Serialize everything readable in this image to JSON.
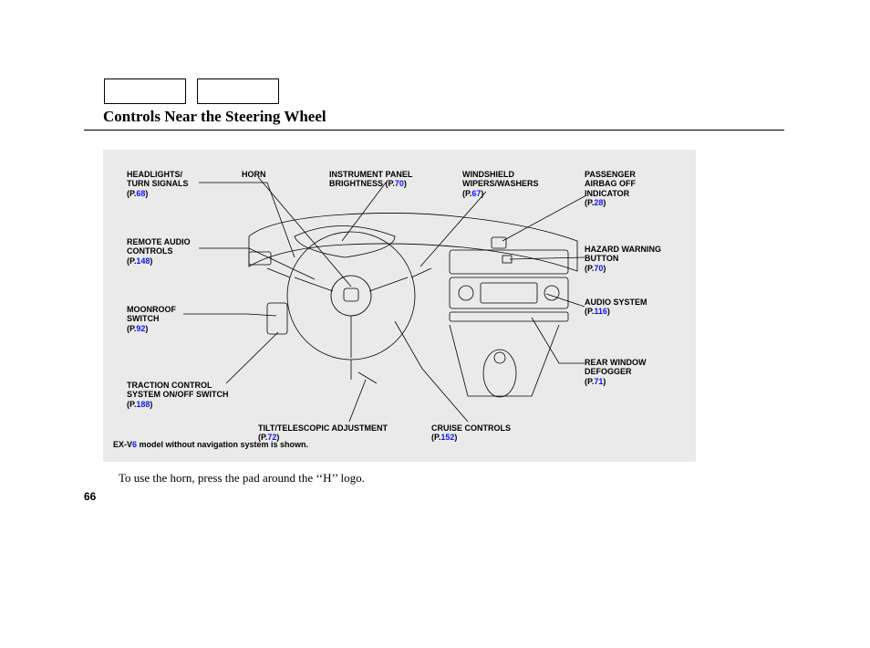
{
  "title": "Controls Near the Steering Wheel",
  "page_number": "66",
  "body_text": "To use the horn, press the pad around the ‘‘H’’ logo.",
  "note_prefix": "EX-V",
  "note_highlight": "6",
  "note_suffix": " model without navigation system is shown.",
  "callouts": {
    "headlights": {
      "label": "HEADLIGHTS/\nTURN SIGNALS",
      "page": "68"
    },
    "remote_audio": {
      "label": "REMOTE AUDIO\nCONTROLS",
      "page": "148"
    },
    "moonroof": {
      "label": "MOONROOF\nSWITCH",
      "page": "92"
    },
    "traction": {
      "label": "TRACTION CONTROL\nSYSTEM ON/OFF SWITCH",
      "page": "188"
    },
    "horn": {
      "label": "HORN",
      "page": ""
    },
    "instrument": {
      "label": "INSTRUMENT PANEL\nBRIGHTNESS",
      "page": "70",
      "inline": true
    },
    "tilt": {
      "label": "TILT/TELESCOPIC ADJUSTMENT",
      "page": "72"
    },
    "cruise": {
      "label": "CRUISE CONTROLS",
      "page": "152"
    },
    "windshield": {
      "label": "WINDSHIELD\nWIPERS/WASHERS",
      "page": "67"
    },
    "passenger": {
      "label": "PASSENGER\nAIRBAG OFF\nINDICATOR",
      "page": "28"
    },
    "hazard": {
      "label": "HAZARD WARNING\nBUTTON",
      "page": "70"
    },
    "audio": {
      "label": "AUDIO SYSTEM",
      "page": "116"
    },
    "rear_defog": {
      "label": "REAR WINDOW\nDEFOGGER",
      "page": "71"
    }
  }
}
